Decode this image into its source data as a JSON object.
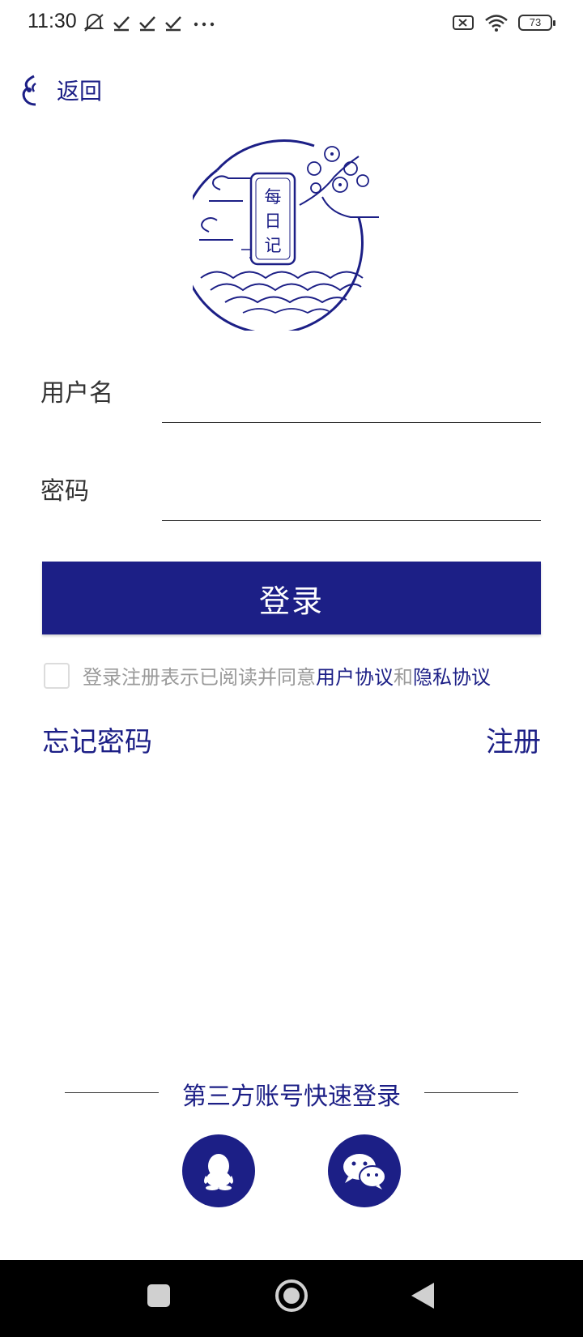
{
  "status_bar": {
    "time": "11:30",
    "battery": "73",
    "icons_left": [
      "mute-vibrate-icon",
      "check-icon",
      "check-icon",
      "check-icon",
      "more-dots-icon"
    ],
    "icons_right": [
      "sim-disabled-icon",
      "wifi-icon",
      "battery-icon"
    ]
  },
  "header": {
    "back_label": "返回"
  },
  "logo": {
    "text": [
      "每",
      "日",
      "记"
    ]
  },
  "form": {
    "username_label": "用户名",
    "username_value": "",
    "password_label": "密码",
    "password_value": "",
    "login_button": "登录"
  },
  "agreement": {
    "prefix": "登录注册表示已阅读并同意",
    "user_agreement": "用户协议",
    "conjunction": "和",
    "privacy_agreement": "隐私协议",
    "checked": false
  },
  "links": {
    "forgot_password": "忘记密码",
    "register": "注册"
  },
  "third_party": {
    "title": "第三方账号快速登录",
    "providers": [
      "qq-icon",
      "wechat-icon"
    ]
  },
  "colors": {
    "brand": "#1c1f86",
    "muted_text": "#9a9a9a",
    "navbar": "#000000"
  }
}
